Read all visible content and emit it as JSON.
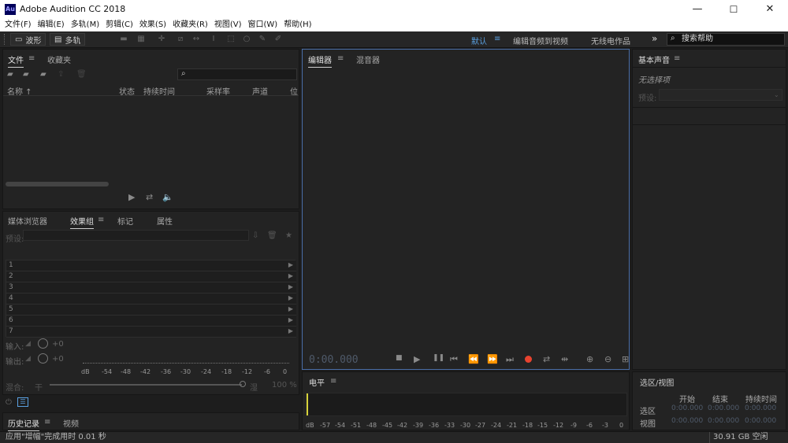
{
  "window": {
    "title": "Adobe Audition CC 2018",
    "app_icon": "Au",
    "minimize": "—",
    "maximize": "☐",
    "close": "✕"
  },
  "menu": [
    "文件(F)",
    "编辑(E)",
    "多轨(M)",
    "剪辑(C)",
    "效果(S)",
    "收藏夹(R)",
    "视图(V)",
    "窗口(W)",
    "帮助(H)"
  ],
  "toolbar": {
    "waveform": "波形",
    "multitrack": "多轨",
    "workspaces": [
      "默认",
      "编辑音频到视频",
      "无线电作品"
    ],
    "more": "»",
    "help_search_placeholder": "搜索帮助"
  },
  "files_panel": {
    "tabs": [
      "文件",
      "收藏夹"
    ],
    "columns": [
      "名称 ↑",
      "状态",
      "持续时间",
      "采样率",
      "声道",
      "位"
    ]
  },
  "effects_panel": {
    "tabs": [
      "媒体浏览器",
      "效果组",
      "标记",
      "属性"
    ],
    "preset_label": "预设:",
    "rows": [
      "1",
      "2",
      "3",
      "4",
      "5",
      "6",
      "7"
    ],
    "input_label": "输入:",
    "output_label": "输出:",
    "db_plus0": "+0",
    "mix_label": "混合:",
    "dry": "干",
    "wet": "湿",
    "mix_value": "100 %",
    "meter_ticks": [
      "dB",
      "-54",
      "-48",
      "-42",
      "-36",
      "-30",
      "-24",
      "-18",
      "-12",
      "-6",
      "0"
    ]
  },
  "history_panel": {
    "tabs": [
      "历史记录",
      "视频"
    ]
  },
  "editor_panel": {
    "tabs": [
      "编辑器",
      "混音器"
    ],
    "time": "0:00.000"
  },
  "levels_panel": {
    "title": "电平",
    "ticks": [
      "dB",
      "-57",
      "-54",
      "-51",
      "-48",
      "-45",
      "-42",
      "-39",
      "-36",
      "-33",
      "-30",
      "-27",
      "-24",
      "-21",
      "-18",
      "-15",
      "-12",
      "-9",
      "-6",
      "-3",
      "0"
    ]
  },
  "essential_sound": {
    "title": "基本声音",
    "no_selection": "无选择项",
    "preset_label": "预设:"
  },
  "selection_panel": {
    "title": "选区/视图",
    "headers": [
      "开始",
      "结束",
      "持续时间"
    ],
    "rows": [
      {
        "label": "选区",
        "start": "0:00.000",
        "end": "0:00.000",
        "dur": "0:00.000"
      },
      {
        "label": "视图",
        "start": "0:00.000",
        "end": "0:00.000",
        "dur": "0:00.000"
      }
    ]
  },
  "status": {
    "message": "应用\"增幅\"完成用时 0.01 秒",
    "disk": "30.91 GB 空闲"
  },
  "colors": {
    "accent": "#5aa0e0",
    "record": "#e8432f",
    "panel": "#232323",
    "highlight_border": "#4a6ea8"
  }
}
